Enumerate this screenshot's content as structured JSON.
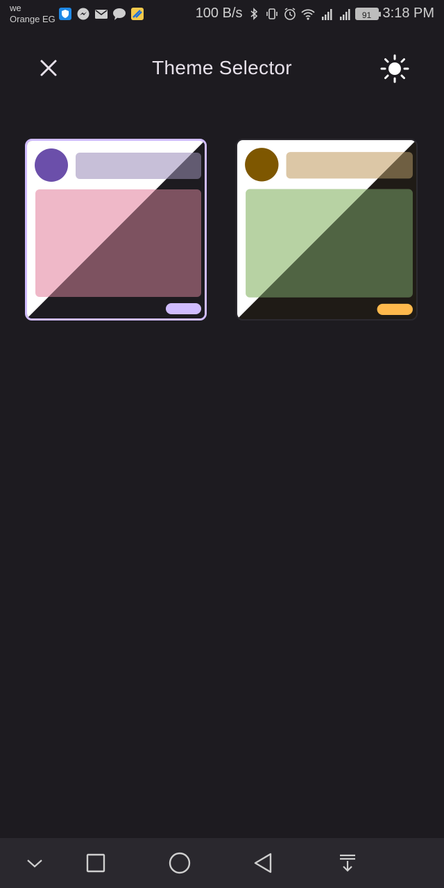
{
  "status_bar": {
    "carrier_line1": "we",
    "carrier_line2": "Orange EG",
    "net_speed": "100 B/s",
    "battery": "91",
    "time": "3:18 PM",
    "icons": [
      "shield-app-icon",
      "messenger-icon",
      "mail-icon",
      "chat-icon",
      "gallery-app-icon",
      "bluetooth-icon",
      "vibrate-icon",
      "alarm-icon",
      "wifi-icon",
      "signal-4g-icon",
      "signal-3g-icon",
      "battery-icon"
    ]
  },
  "app_bar": {
    "title": "Theme Selector",
    "close_icon": "close-icon",
    "mode_icon": "sun-icon"
  },
  "themes": [
    {
      "selected": true,
      "light": {
        "circle": "#6b4faa",
        "bar": "#c7bfd8",
        "panel": "#efb8c8",
        "chip": "#d0bcff",
        "background": "#ffffff"
      },
      "dark": {
        "circle": "#6b4faa",
        "bar": "#625b71",
        "panel": "#7d5260",
        "chip": "#d0bcff",
        "background": "#1d1b20"
      },
      "border_color": "#d0bcff"
    },
    {
      "selected": false,
      "light": {
        "circle": "#7e5700",
        "bar": "#dcc7a6",
        "panel": "#b7d2a3",
        "chip": "#ffb94c",
        "background": "#ffffff"
      },
      "dark": {
        "circle": "#7e5700",
        "bar": "#6f5f42",
        "panel": "#506443",
        "chip": "#ffb94c",
        "background": "#1f1b16"
      },
      "border_color": "#2c2a30"
    }
  ],
  "nav_bar": {
    "buttons": [
      "chevron-down-icon",
      "square-recents-icon",
      "circle-home-icon",
      "triangle-back-icon",
      "notification-pull-icon"
    ]
  },
  "colors": {
    "background": "#1d1b20",
    "on_surface": "#e6e0e9",
    "accent": "#d0bcff"
  }
}
